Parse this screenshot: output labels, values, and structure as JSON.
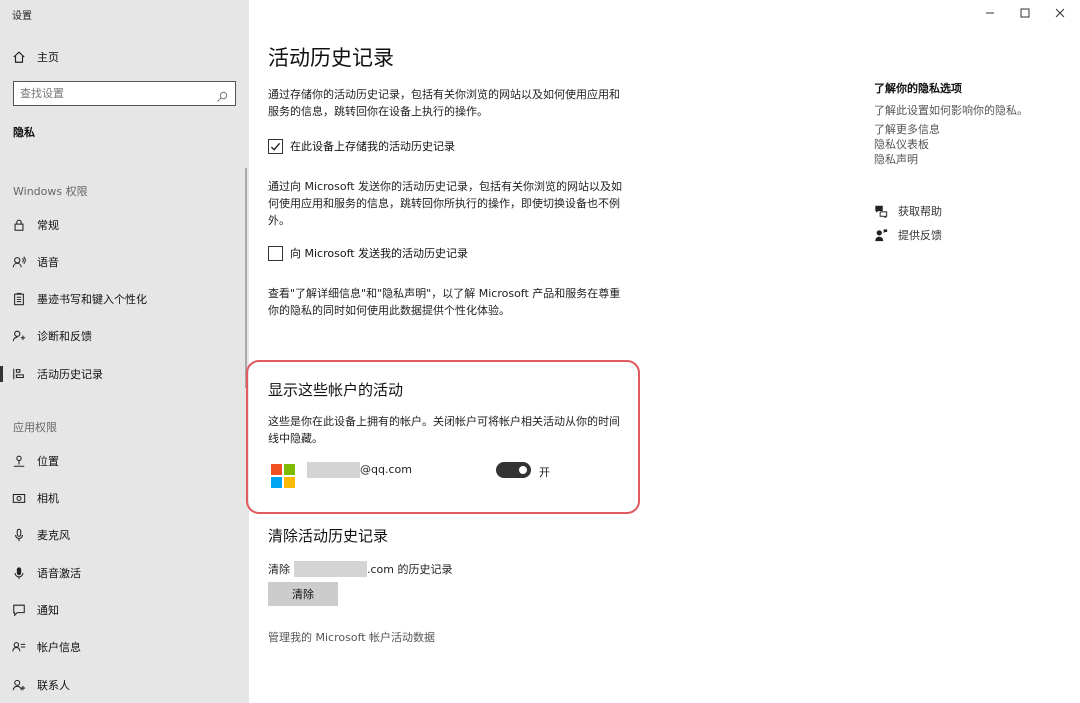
{
  "window": {
    "title": "设置",
    "minimize_glyph": "minimize-icon",
    "maximize_glyph": "maximize-icon",
    "close_glyph": "close-icon"
  },
  "sidebar": {
    "home_label": "主页",
    "search_placeholder": "查找设置",
    "current_section": "隐私",
    "windows_permissions_label": "Windows 权限",
    "windows_items": [
      {
        "label": "常规",
        "icon": "lock-icon"
      },
      {
        "label": "语音",
        "icon": "speech-icon"
      },
      {
        "label": "墨迹书写和键入个性化",
        "icon": "clipboard-icon"
      },
      {
        "label": "诊断和反馈",
        "icon": "diagnostics-icon"
      },
      {
        "label": "活动历史记录",
        "icon": "timeline-icon",
        "active": true
      }
    ],
    "app_permissions_label": "应用权限",
    "app_items": [
      {
        "label": "位置",
        "icon": "location-icon"
      },
      {
        "label": "相机",
        "icon": "camera-icon"
      },
      {
        "label": "麦克风",
        "icon": "microphone-icon"
      },
      {
        "label": "语音激活",
        "icon": "voice-activation-icon"
      },
      {
        "label": "通知",
        "icon": "notification-icon"
      },
      {
        "label": "帐户信息",
        "icon": "account-info-icon"
      },
      {
        "label": "联系人",
        "icon": "contacts-icon"
      }
    ]
  },
  "main": {
    "title": "活动历史记录",
    "store_desc": "通过存储你的活动历史记录，包括有关你浏览的网站以及如何使用应用和服务的信息，跳转回你在设备上执行的操作。",
    "store_checkbox_label": "在此设备上存储我的活动历史记录",
    "store_checked": true,
    "send_desc": "通过向 Microsoft 发送你的活动历史记录，包括有关你浏览的网站以及如何使用应用和服务的信息，跳转回你所执行的操作，即使切换设备也不例外。",
    "send_checkbox_label": "向 Microsoft 发送我的活动历史记录",
    "send_checked": false,
    "privacy_note": "查看\"了解详细信息\"和\"隐私声明\"，以了解 Microsoft 产品和服务在尊重你的隐私的同时如何使用此数据提供个性化体验。",
    "accounts_title": "显示这些帐户的活动",
    "accounts_desc": "这些是你在此设备上拥有的帐户。关闭帐户可将帐户相关活动从你的时间线中隐藏。",
    "account_email_suffix": "@qq.com",
    "account_toggle_on": true,
    "account_toggle_label": "开",
    "clear_title": "清除活动历史记录",
    "clear_prefix": "清除",
    "clear_suffix": ".com 的历史记录",
    "clear_button": "清除",
    "manage_link": "管理我的 Microsoft 帐户活动数据"
  },
  "right": {
    "heading": "了解你的隐私选项",
    "desc": "了解此设置如何影响你的隐私。",
    "links": [
      "了解更多信息",
      "隐私仪表板",
      "隐私声明"
    ],
    "help_label": "获取帮助",
    "feedback_label": "提供反馈"
  }
}
